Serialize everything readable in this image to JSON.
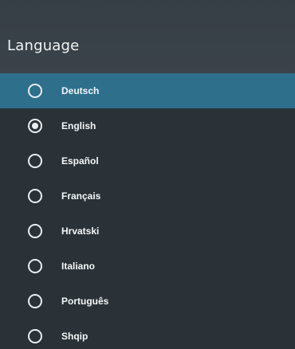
{
  "dialog": {
    "title": "Language"
  },
  "languages": [
    {
      "label": "Deutsch",
      "selected": false,
      "focused": true
    },
    {
      "label": "English",
      "selected": true,
      "focused": false
    },
    {
      "label": "Español",
      "selected": false,
      "focused": false
    },
    {
      "label": "Français",
      "selected": false,
      "focused": false
    },
    {
      "label": "Hrvatski",
      "selected": false,
      "focused": false
    },
    {
      "label": "Italiano",
      "selected": false,
      "focused": false
    },
    {
      "label": "Português",
      "selected": false,
      "focused": false
    },
    {
      "label": "Shqip",
      "selected": false,
      "focused": false
    }
  ],
  "colors": {
    "background": "#2a3238",
    "header": "#3a4349",
    "focus_highlight": "#2e6f8c",
    "text": "#f4f6f7"
  }
}
